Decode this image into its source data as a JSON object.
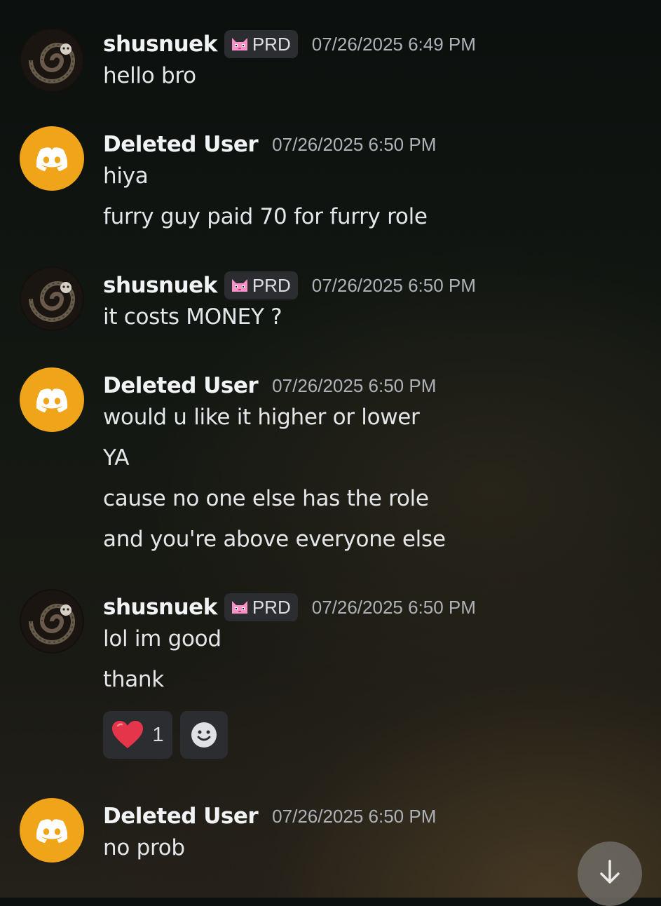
{
  "messages": [
    {
      "author": "shusnuek",
      "tag": "PRD",
      "time": "07/26/2025 6:49 PM",
      "lines": [
        "hello bro"
      ]
    },
    {
      "author": "Deleted User",
      "time": "07/26/2025 6:50 PM",
      "lines": [
        "hiya",
        "furry guy paid 70 for furry role"
      ]
    },
    {
      "author": "shusnuek",
      "tag": "PRD",
      "time": "07/26/2025 6:50 PM",
      "lines": [
        "it costs MONEY ?"
      ]
    },
    {
      "author": "Deleted User",
      "time": "07/26/2025 6:50 PM",
      "lines": [
        "would u like it higher or lower",
        "YA",
        "cause no one else has the role",
        "and you're above everyone else"
      ]
    },
    {
      "author": "shusnuek",
      "tag": "PRD",
      "time": "07/26/2025 6:50 PM",
      "lines": [
        "lol  im good",
        "thank"
      ],
      "reactions": {
        "heart_count": "1"
      }
    },
    {
      "author": "Deleted User",
      "time": "07/26/2025 6:50 PM",
      "lines": [
        "no prob"
      ]
    }
  ],
  "colors": {
    "discord_avatar": "#f0a41a",
    "heart": "#e5354a",
    "tag_bg": "#2b2d31"
  },
  "icons": {
    "tag_icon": "pink-cat-icon",
    "reaction_emoji": "heart-icon",
    "add_reaction": "smile-add-reaction-icon",
    "scroll": "arrow-down-icon"
  }
}
